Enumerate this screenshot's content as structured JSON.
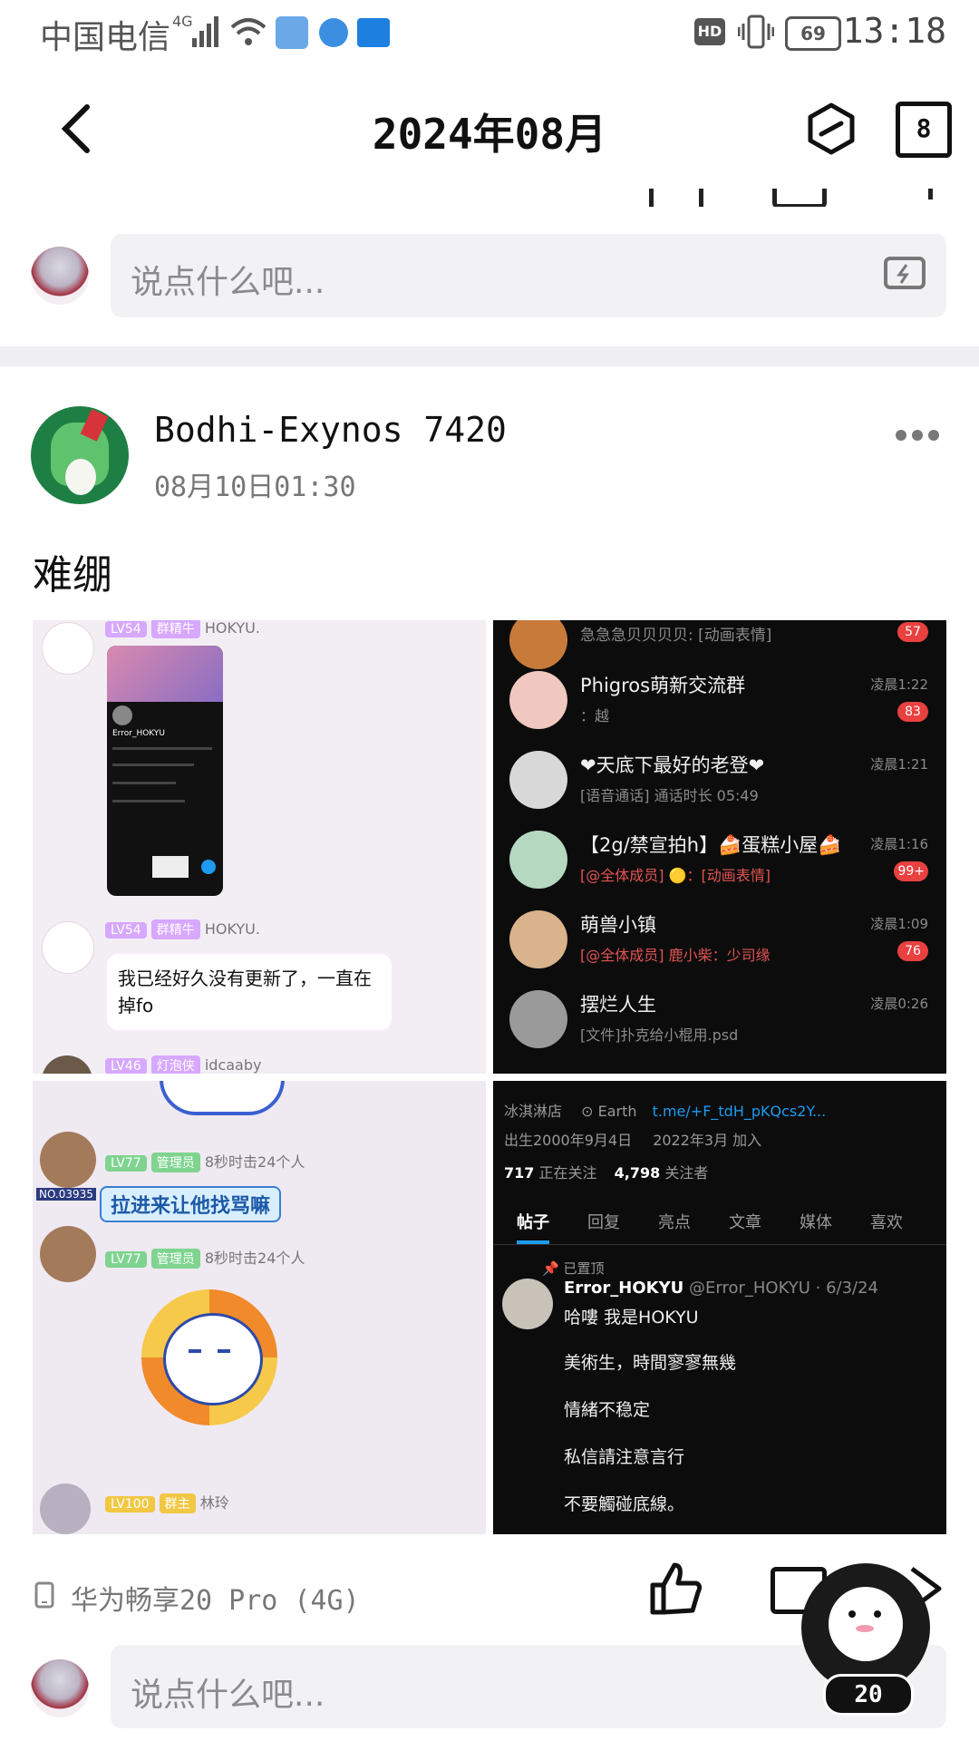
{
  "status_bar": {
    "carrier": "中国电信",
    "network": "4G",
    "battery": "69",
    "time": "13:18"
  },
  "nav": {
    "title": "2024年08月",
    "calendar_day": "8"
  },
  "top_comment": {
    "placeholder": "说点什么吧..."
  },
  "post": {
    "username": "Bodhi-Exynos 7420",
    "time": "08月10日01:30",
    "text": "难绷",
    "device": "华为畅享20 Pro (4G)"
  },
  "bottom_comment": {
    "placeholder": "说点什么吧..."
  },
  "floating_badge": "20",
  "tile1": {
    "sender1_level": "LV54",
    "sender1_title": "群精牛",
    "sender1_name": "HOKYU.",
    "sender2_level": "LV54",
    "sender2_title": "群精牛",
    "sender2_name": "HOKYU.",
    "message": "我已经好久没有更新了，一直在掉fo",
    "sender3_level": "LV46",
    "sender3_title": "灯泡侠",
    "sender3_name": "idcaaby",
    "phone_name": "Error_HOKYU"
  },
  "tile2": {
    "chats": [
      {
        "name": "急急急贝贝贝贝: [动画表情]",
        "sub": "",
        "time": "",
        "badge": "57",
        "color": "#c87a3a"
      },
      {
        "name": "Phigros萌新交流群",
        "sub": "：越",
        "time": "凌晨1:22",
        "badge": "83",
        "color": "#f0c8c0"
      },
      {
        "name": "❤天底下最好的老登❤",
        "sub": "[语音通话] 通话时长 05:49",
        "time": "凌晨1:21",
        "badge": "",
        "color": "#d8d8d8"
      },
      {
        "name": "【2g/禁宣拍h】🍰蛋糕小屋🍰",
        "sub": "[@全体成员] 🟡：[动画表情]",
        "time": "凌晨1:16",
        "badge": "99+",
        "color": "#b5d8c0"
      },
      {
        "name": "萌兽小镇",
        "sub": "[@全体成员] 鹿小柴：少司缘",
        "time": "凌晨1:09",
        "badge": "76",
        "color": "#d9b38c"
      },
      {
        "name": "摆烂人生",
        "sub": "[文件]扑克给小棍用.psd",
        "time": "凌晨0:26",
        "badge": "",
        "color": "#9a9a9a"
      }
    ]
  },
  "tile3": {
    "caption": "拉进来让他找骂嘛",
    "admin_level": "LV77",
    "admin_title": "管理员",
    "admin_name": "8秒时击24个人",
    "admin2_level": "LV77",
    "admin2_title": "管理员",
    "admin2_name": "8秒时击24个人",
    "owner_level": "LV100",
    "owner_title": "群主",
    "owner_name": "林玲",
    "number_tag": "NO.03935"
  },
  "tile4": {
    "location_shop": "冰淇淋店",
    "location": "Earth",
    "link": "t.me/+F_tdH_pKQcs2Y...",
    "birth": "出生2000年9月4日",
    "joined": "2022年3月 加入",
    "following_count": "717",
    "following_label": "正在关注",
    "followers_count": "4,798",
    "followers_label": "关注者",
    "tabs": [
      "帖子",
      "回复",
      "亮点",
      "文章",
      "媒体",
      "喜欢"
    ],
    "pinned": "已置顶",
    "author": "Error_HOKYU",
    "handle": "@Error_HOKYU · 6/3/24",
    "lines": [
      "哈嘍 我是HOKYU",
      "美術生，時間寥寥無幾",
      "情緒不稳定",
      "私信請注意言行",
      "不要觸碰底線。"
    ]
  },
  "colors": {
    "accent_blue": "#1d9bf0",
    "badge_red": "#e94040",
    "input_bg": "#f2f2f4"
  }
}
